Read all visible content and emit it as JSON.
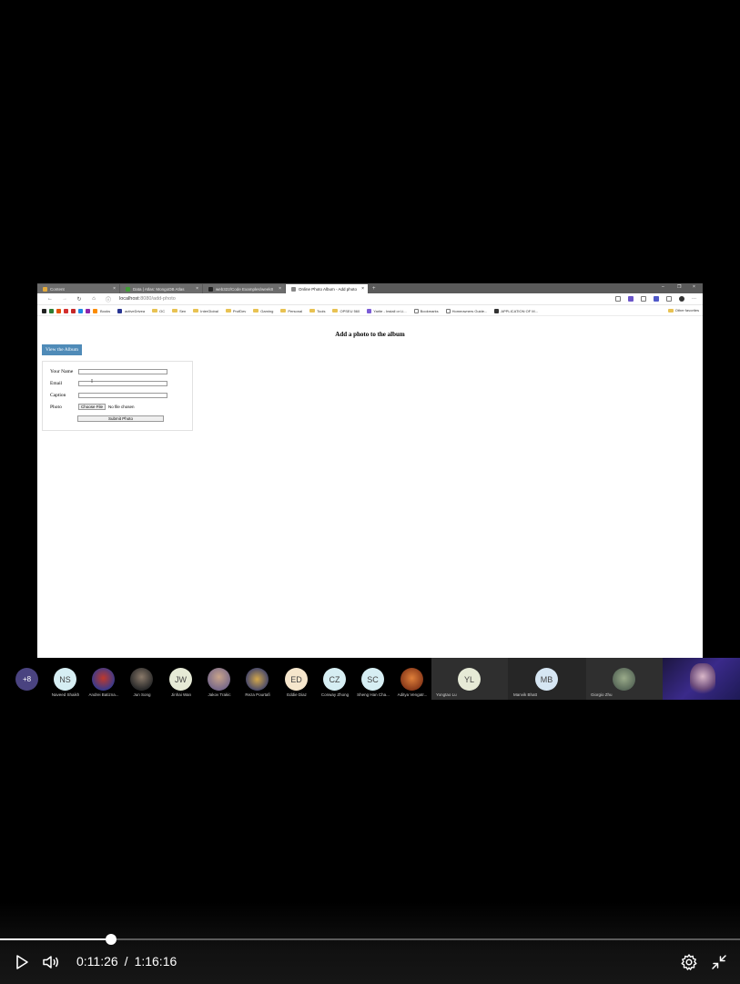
{
  "browser": {
    "tabs": [
      {
        "label": "Content",
        "active": false,
        "color": "#e2a93b"
      },
      {
        "label": "Data | Atlas: MongoDB Atlas",
        "active": false,
        "color": "#3f9c35"
      },
      {
        "label": "web322/Code Examples/week8",
        "active": false,
        "color": "#222222"
      },
      {
        "label": "Online Photo Album - Add photo",
        "active": true,
        "color": "#888888"
      }
    ],
    "url_host": "localhost",
    "url_rest": ":8080/add-photo",
    "bookmarks": [
      {
        "label": "Books",
        "type": "page"
      },
      {
        "label": "activeDrivea",
        "type": "page"
      },
      {
        "label": "OC",
        "type": "folder"
      },
      {
        "label": "Sen",
        "type": "folder"
      },
      {
        "label": "InterGlobal",
        "type": "folder"
      },
      {
        "label": "ProfDev",
        "type": "folder"
      },
      {
        "label": "Gaming",
        "type": "folder"
      },
      {
        "label": "Personal",
        "type": "folder"
      },
      {
        "label": "Tools",
        "type": "folder"
      },
      {
        "label": "OPSEU 560",
        "type": "folder"
      },
      {
        "label": "Yarite - Install or Li...",
        "type": "page"
      },
      {
        "label": "Bookmarks",
        "type": "page"
      },
      {
        "label": "Homeowners Guide...",
        "type": "page"
      },
      {
        "label": "APPLICATION OF M...",
        "type": "page"
      }
    ],
    "other_favorites": "Other favorites"
  },
  "page": {
    "title": "Add a photo to the album",
    "view_album_label": "View the Album",
    "form": {
      "name_label": "Your Name",
      "email_label": "Email",
      "caption_label": "Caption",
      "photo_label": "Photo",
      "choose_file_label": "Choose File",
      "file_status": "No file chosen",
      "submit_label": "Submit Photo"
    }
  },
  "participants": {
    "more_count": "+8",
    "people": [
      {
        "initials": "NS",
        "name": "Naveed Shaikh",
        "bg": "#d6eef3"
      },
      {
        "initials": "",
        "name": "Andrei Batizna...",
        "bg": "#3a3a8c"
      },
      {
        "initials": "",
        "name": "Jun Song",
        "bg": "#4a4a4a"
      },
      {
        "initials": "JW",
        "name": "Jinhai Wan",
        "bg": "#e6ead6"
      },
      {
        "initials": "",
        "name": "Jakov Trakic",
        "bg": "#7a6a8a"
      },
      {
        "initials": "",
        "name": "Reza Pourtafi",
        "bg": "#6a6a4a"
      },
      {
        "initials": "ED",
        "name": "Eddie Diaz",
        "bg": "#f6e6cc"
      },
      {
        "initials": "CZ",
        "name": "Conway Zhong",
        "bg": "#d6eef3"
      },
      {
        "initials": "SC",
        "name": "Sheng Han Cha...",
        "bg": "#d6eef3"
      },
      {
        "initials": "",
        "name": "Aditya Vengatr...",
        "bg": "#c86a3a"
      }
    ],
    "tiles": [
      {
        "initials": "YL",
        "name": "Yongtao Lu",
        "bg": "#e6ead6"
      },
      {
        "initials": "MB",
        "name": "Manvik Bhatt",
        "bg": "#d6e6f3"
      },
      {
        "initials": "",
        "name": "Giorgio Zhu",
        "bg": "#5a6a5a"
      }
    ]
  },
  "player": {
    "current_time": "0:11:26",
    "separator": "/",
    "total_time": "1:16:16",
    "progress": 0.15,
    "icons": [
      "play-icon",
      "volume-icon",
      "settings-icon",
      "exit-fullscreen-icon"
    ]
  }
}
